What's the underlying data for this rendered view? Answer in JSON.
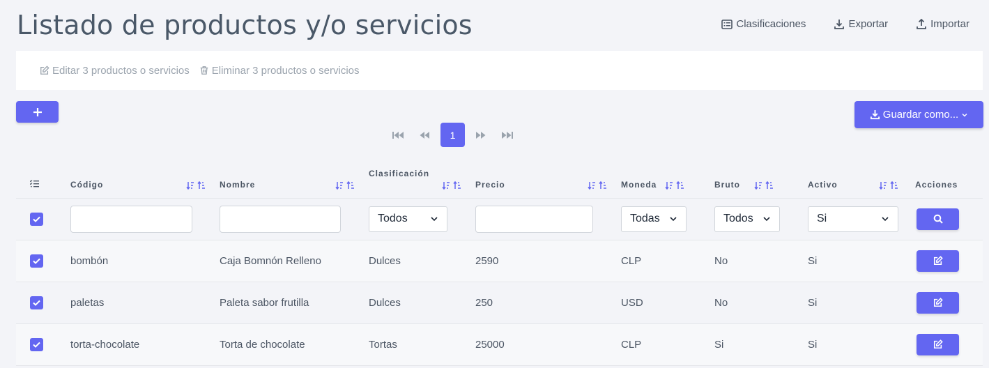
{
  "header": {
    "title": "Listado de productos y/o servicios",
    "actions": [
      {
        "label": "Clasificaciones",
        "icon": "list-icon"
      },
      {
        "label": "Exportar",
        "icon": "download-icon"
      },
      {
        "label": "Importar",
        "icon": "upload-icon"
      }
    ]
  },
  "bulk": {
    "edit_label": "Editar 3 productos o servicios",
    "delete_label": "Eliminar 3 productos o servicios"
  },
  "toolbar": {
    "add_icon": "plus-icon",
    "save_label": "Guardar como...",
    "current_page": "1"
  },
  "table": {
    "columns": {
      "codigo": "Código",
      "nombre": "Nombre",
      "clasificacion": "Clasificación",
      "precio": "Precio",
      "moneda": "Moneda",
      "bruto": "Bruto",
      "activo": "Activo",
      "acciones": "Acciones"
    },
    "filters": {
      "codigo": "",
      "nombre": "",
      "clasificacion": "Todos",
      "precio": "",
      "moneda": "Todas",
      "bruto": "Todos",
      "activo": "Si"
    },
    "rows": [
      {
        "codigo": "bombón",
        "nombre": "Caja Bomnón Relleno",
        "clasificacion": "Dulces",
        "precio": "2590",
        "moneda": "CLP",
        "bruto": "No",
        "activo": "Si"
      },
      {
        "codigo": "paletas",
        "nombre": "Paleta sabor frutilla",
        "clasificacion": "Dulces",
        "precio": "250",
        "moneda": "USD",
        "bruto": "No",
        "activo": "Si"
      },
      {
        "codigo": "torta-chocolate",
        "nombre": "Torta de chocolate",
        "clasificacion": "Tortas",
        "precio": "25000",
        "moneda": "CLP",
        "bruto": "Si",
        "activo": "Si"
      }
    ]
  },
  "colors": {
    "accent": "#6366f1",
    "background": "#f3f4f8"
  }
}
